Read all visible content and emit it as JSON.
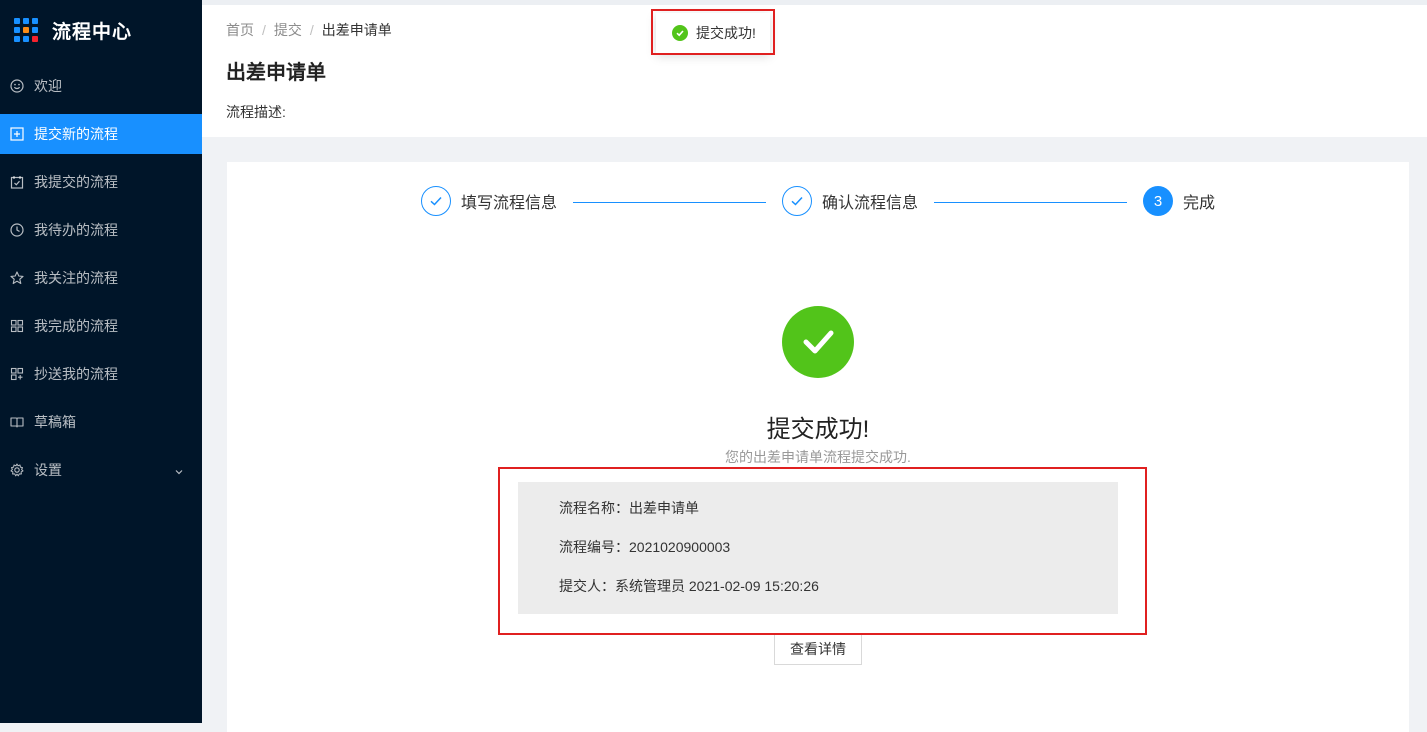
{
  "app": {
    "title": "流程中心"
  },
  "colors": {
    "sidebar": "#001529",
    "accent": "#1890ff",
    "success": "#52c41a",
    "highlight": "#e02020"
  },
  "sidebar": {
    "items": [
      {
        "label": "欢迎",
        "icon": "smile-icon",
        "active": false
      },
      {
        "label": "提交新的流程",
        "icon": "plus-square-icon",
        "active": true
      },
      {
        "label": "我提交的流程",
        "icon": "calendar-check-icon",
        "active": false
      },
      {
        "label": "我待办的流程",
        "icon": "clock-icon",
        "active": false
      },
      {
        "label": "我关注的流程",
        "icon": "star-icon",
        "active": false
      },
      {
        "label": "我完成的流程",
        "icon": "appstore-icon",
        "active": false
      },
      {
        "label": "抄送我的流程",
        "icon": "copy-grid-icon",
        "active": false
      },
      {
        "label": "草稿箱",
        "icon": "book-icon",
        "active": false
      },
      {
        "label": "设置",
        "icon": "gear-icon",
        "active": false,
        "expandable": true
      }
    ]
  },
  "breadcrumb": {
    "items": [
      "首页",
      "提交",
      "出差申请单"
    ],
    "separator": "/"
  },
  "page": {
    "title": "出差申请单",
    "description": "流程描述:"
  },
  "toast": {
    "message": "提交成功!",
    "icon": "check-circle-icon"
  },
  "steps": [
    {
      "label": "填写流程信息",
      "status": "done"
    },
    {
      "label": "确认流程信息",
      "status": "done"
    },
    {
      "label": "完成",
      "status": "current",
      "number": "3"
    }
  ],
  "result": {
    "icon": "check-circle-icon",
    "title": "提交成功!",
    "subtitle": "您的出差申请单流程提交成功.",
    "info": {
      "name_row": "流程名称：出差申请单",
      "number_row": "流程编号：2021020900003",
      "submitter_row": "提交人：系统管理员 2021-02-09 15:20:26"
    },
    "detail_button": "查看详情"
  }
}
